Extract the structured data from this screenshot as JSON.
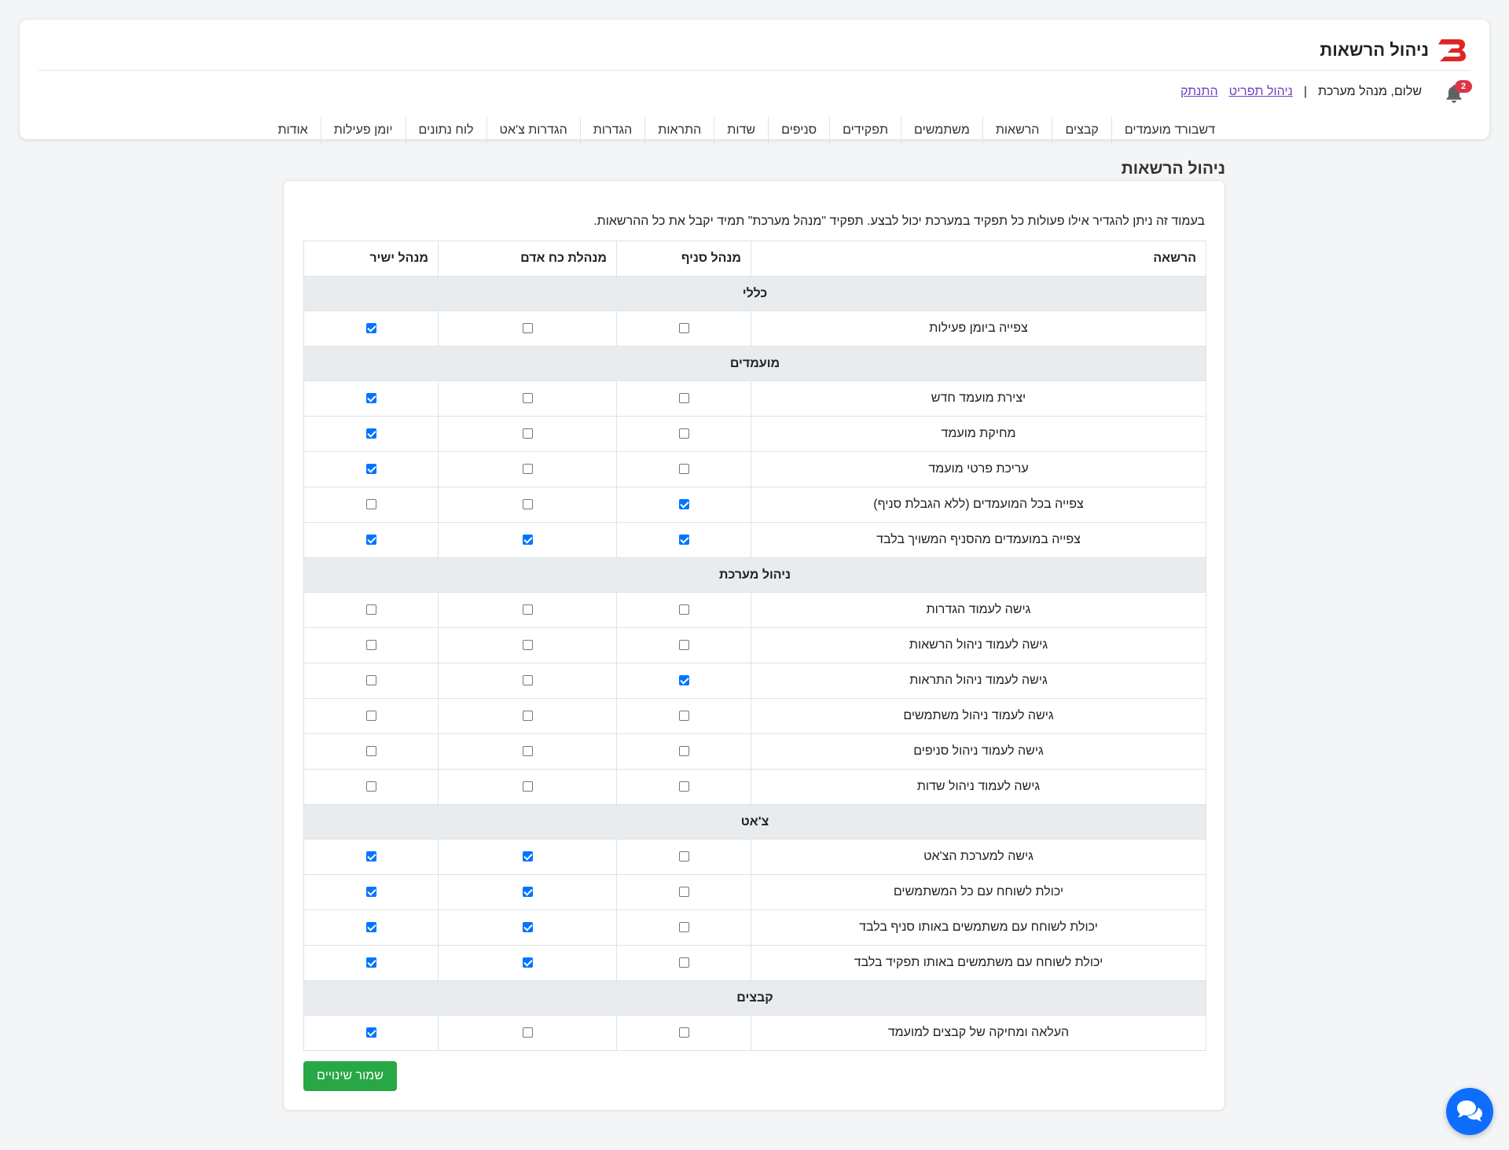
{
  "header": {
    "title": "ניהול הרשאות",
    "notification_count": "2",
    "greeting": "שלום, מנהל מערכת",
    "separator": "|",
    "menu_management_link": "ניהול תפריט",
    "logout_link": "התנתק"
  },
  "nav": {
    "items": [
      {
        "label": "דשבורד מועמדים"
      },
      {
        "label": "קבצים"
      },
      {
        "label": "הרשאות"
      },
      {
        "label": "משתמשים"
      },
      {
        "label": "תפקידים"
      },
      {
        "label": "סניפים"
      },
      {
        "label": "שדות"
      },
      {
        "label": "התראות"
      },
      {
        "label": "הגדרות"
      },
      {
        "label": "הגדרות צ'אט"
      },
      {
        "label": "לוח נתונים"
      },
      {
        "label": "יומן פעילות"
      },
      {
        "label": "אודות"
      }
    ]
  },
  "page": {
    "title": "ניהול הרשאות",
    "intro": "בעמוד זה ניתן להגדיר אילו פעולות כל תפקיד במערכת יכול לבצע. תפקיד \"מנהל מערכת\" תמיד יקבל את כל ההרשאות.",
    "save_label": "שמור שינויים"
  },
  "table": {
    "headers": [
      "הרשאה",
      "מנהל סניף",
      "מנהלת כח אדם",
      "מנהל ישיר"
    ],
    "sections": [
      {
        "title": "כללי",
        "rows": [
          {
            "name": "צפייה ביומן פעילות",
            "values": [
              false,
              false,
              true
            ]
          }
        ]
      },
      {
        "title": "מועמדים",
        "rows": [
          {
            "name": "יצירת מועמד חדש",
            "values": [
              false,
              false,
              true
            ]
          },
          {
            "name": "מחיקת מועמד",
            "values": [
              false,
              false,
              true
            ]
          },
          {
            "name": "עריכת פרטי מועמד",
            "values": [
              false,
              false,
              true
            ]
          },
          {
            "name": "צפייה בכל המועמדים (ללא הגבלת סניף)",
            "values": [
              true,
              false,
              false
            ]
          },
          {
            "name": "צפייה במועמדים מהסניף המשויך בלבד",
            "values": [
              true,
              true,
              true
            ]
          }
        ]
      },
      {
        "title": "ניהול מערכת",
        "rows": [
          {
            "name": "גישה לעמוד הגדרות",
            "values": [
              false,
              false,
              false
            ]
          },
          {
            "name": "גישה לעמוד ניהול הרשאות",
            "values": [
              false,
              false,
              false
            ]
          },
          {
            "name": "גישה לעמוד ניהול התראות",
            "values": [
              true,
              false,
              false
            ]
          },
          {
            "name": "גישה לעמוד ניהול משתמשים",
            "values": [
              false,
              false,
              false
            ]
          },
          {
            "name": "גישה לעמוד ניהול סניפים",
            "values": [
              false,
              false,
              false
            ]
          },
          {
            "name": "גישה לעמוד ניהול שדות",
            "values": [
              false,
              false,
              false
            ]
          }
        ]
      },
      {
        "title": "צ'אט",
        "rows": [
          {
            "name": "גישה למערכת הצ'אט",
            "values": [
              false,
              true,
              true
            ]
          },
          {
            "name": "יכולת לשוחח עם כל המשתמשים",
            "values": [
              false,
              true,
              true
            ]
          },
          {
            "name": "יכולת לשוחח עם משתמשים באותו סניף בלבד",
            "values": [
              false,
              true,
              true
            ]
          },
          {
            "name": "יכולת לשוחח עם משתמשים באותו תפקיד בלבד",
            "values": [
              false,
              true,
              true
            ]
          }
        ]
      },
      {
        "title": "קבצים",
        "rows": [
          {
            "name": "העלאה ומחיקה של קבצים למועמד",
            "values": [
              false,
              false,
              true
            ]
          }
        ]
      }
    ]
  },
  "icons": {
    "logo": "brand-b-logo",
    "bell": "bell-icon",
    "chat": "chat-bubbles-icon"
  },
  "colors": {
    "accent_blue": "#0d6efd",
    "save_green": "#28a745",
    "badge_red": "#dc3545",
    "logo_red": "#e02424",
    "section_bg": "#e9ecef"
  }
}
